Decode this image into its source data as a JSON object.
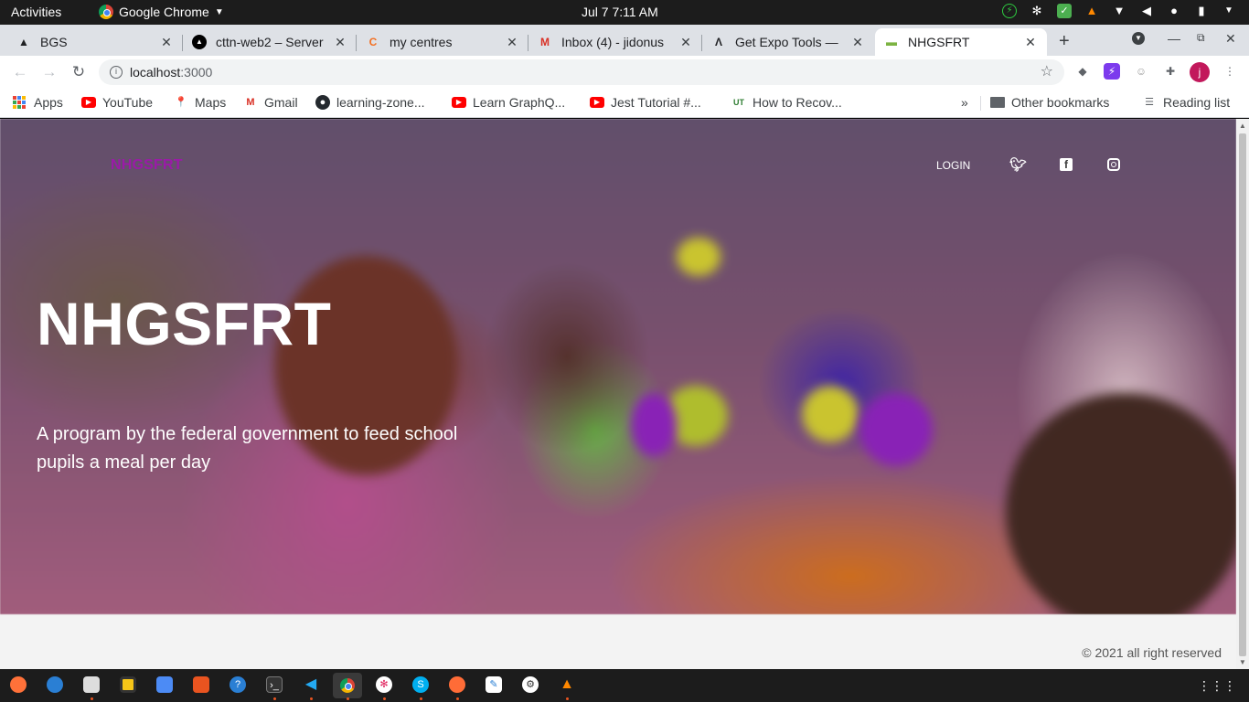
{
  "system_bar": {
    "activities": "Activities",
    "app_name": "Google Chrome",
    "datetime": "Jul 7   7:11 AM"
  },
  "tabs": [
    {
      "title": "BGS",
      "icon": "triangle-icon"
    },
    {
      "title": "cttn-web2 – Server",
      "icon": "vercel-icon"
    },
    {
      "title": "my centres",
      "icon": "c-logo-icon"
    },
    {
      "title": "Inbox (4) - jidonus",
      "icon": "gmail-icon"
    },
    {
      "title": "Get Expo Tools —",
      "icon": "expo-icon"
    },
    {
      "title": "NHGSFRT",
      "icon": "page-icon",
      "active": true
    }
  ],
  "address_bar": {
    "host": "localhost",
    "port": ":3000"
  },
  "profile_initial": "j",
  "bookmarks": [
    {
      "label": "Apps",
      "icon": "apps-grid-icon"
    },
    {
      "label": "YouTube",
      "icon": "youtube-icon"
    },
    {
      "label": "Maps",
      "icon": "maps-icon"
    },
    {
      "label": "Gmail",
      "icon": "gmail-icon"
    },
    {
      "label": "learning-zone...",
      "icon": "github-icon"
    },
    {
      "label": "Learn GraphQ...",
      "icon": "youtube-icon"
    },
    {
      "label": "Jest Tutorial #...",
      "icon": "youtube-icon"
    },
    {
      "label": "How to Recov...",
      "icon": "ut-icon"
    }
  ],
  "bookmarks_overflow": "»",
  "other_bookmarks": "Other bookmarks",
  "reading_list": "Reading list",
  "site": {
    "brand": "NHGSFRT",
    "nav_login": "LOGIN",
    "hero_title": "NHGSFRT",
    "hero_subtitle": "A program by the federal government to feed school pupils a meal per day",
    "footer": "© 2021 all right reserved",
    "brand_color": "#9b1aa8"
  }
}
